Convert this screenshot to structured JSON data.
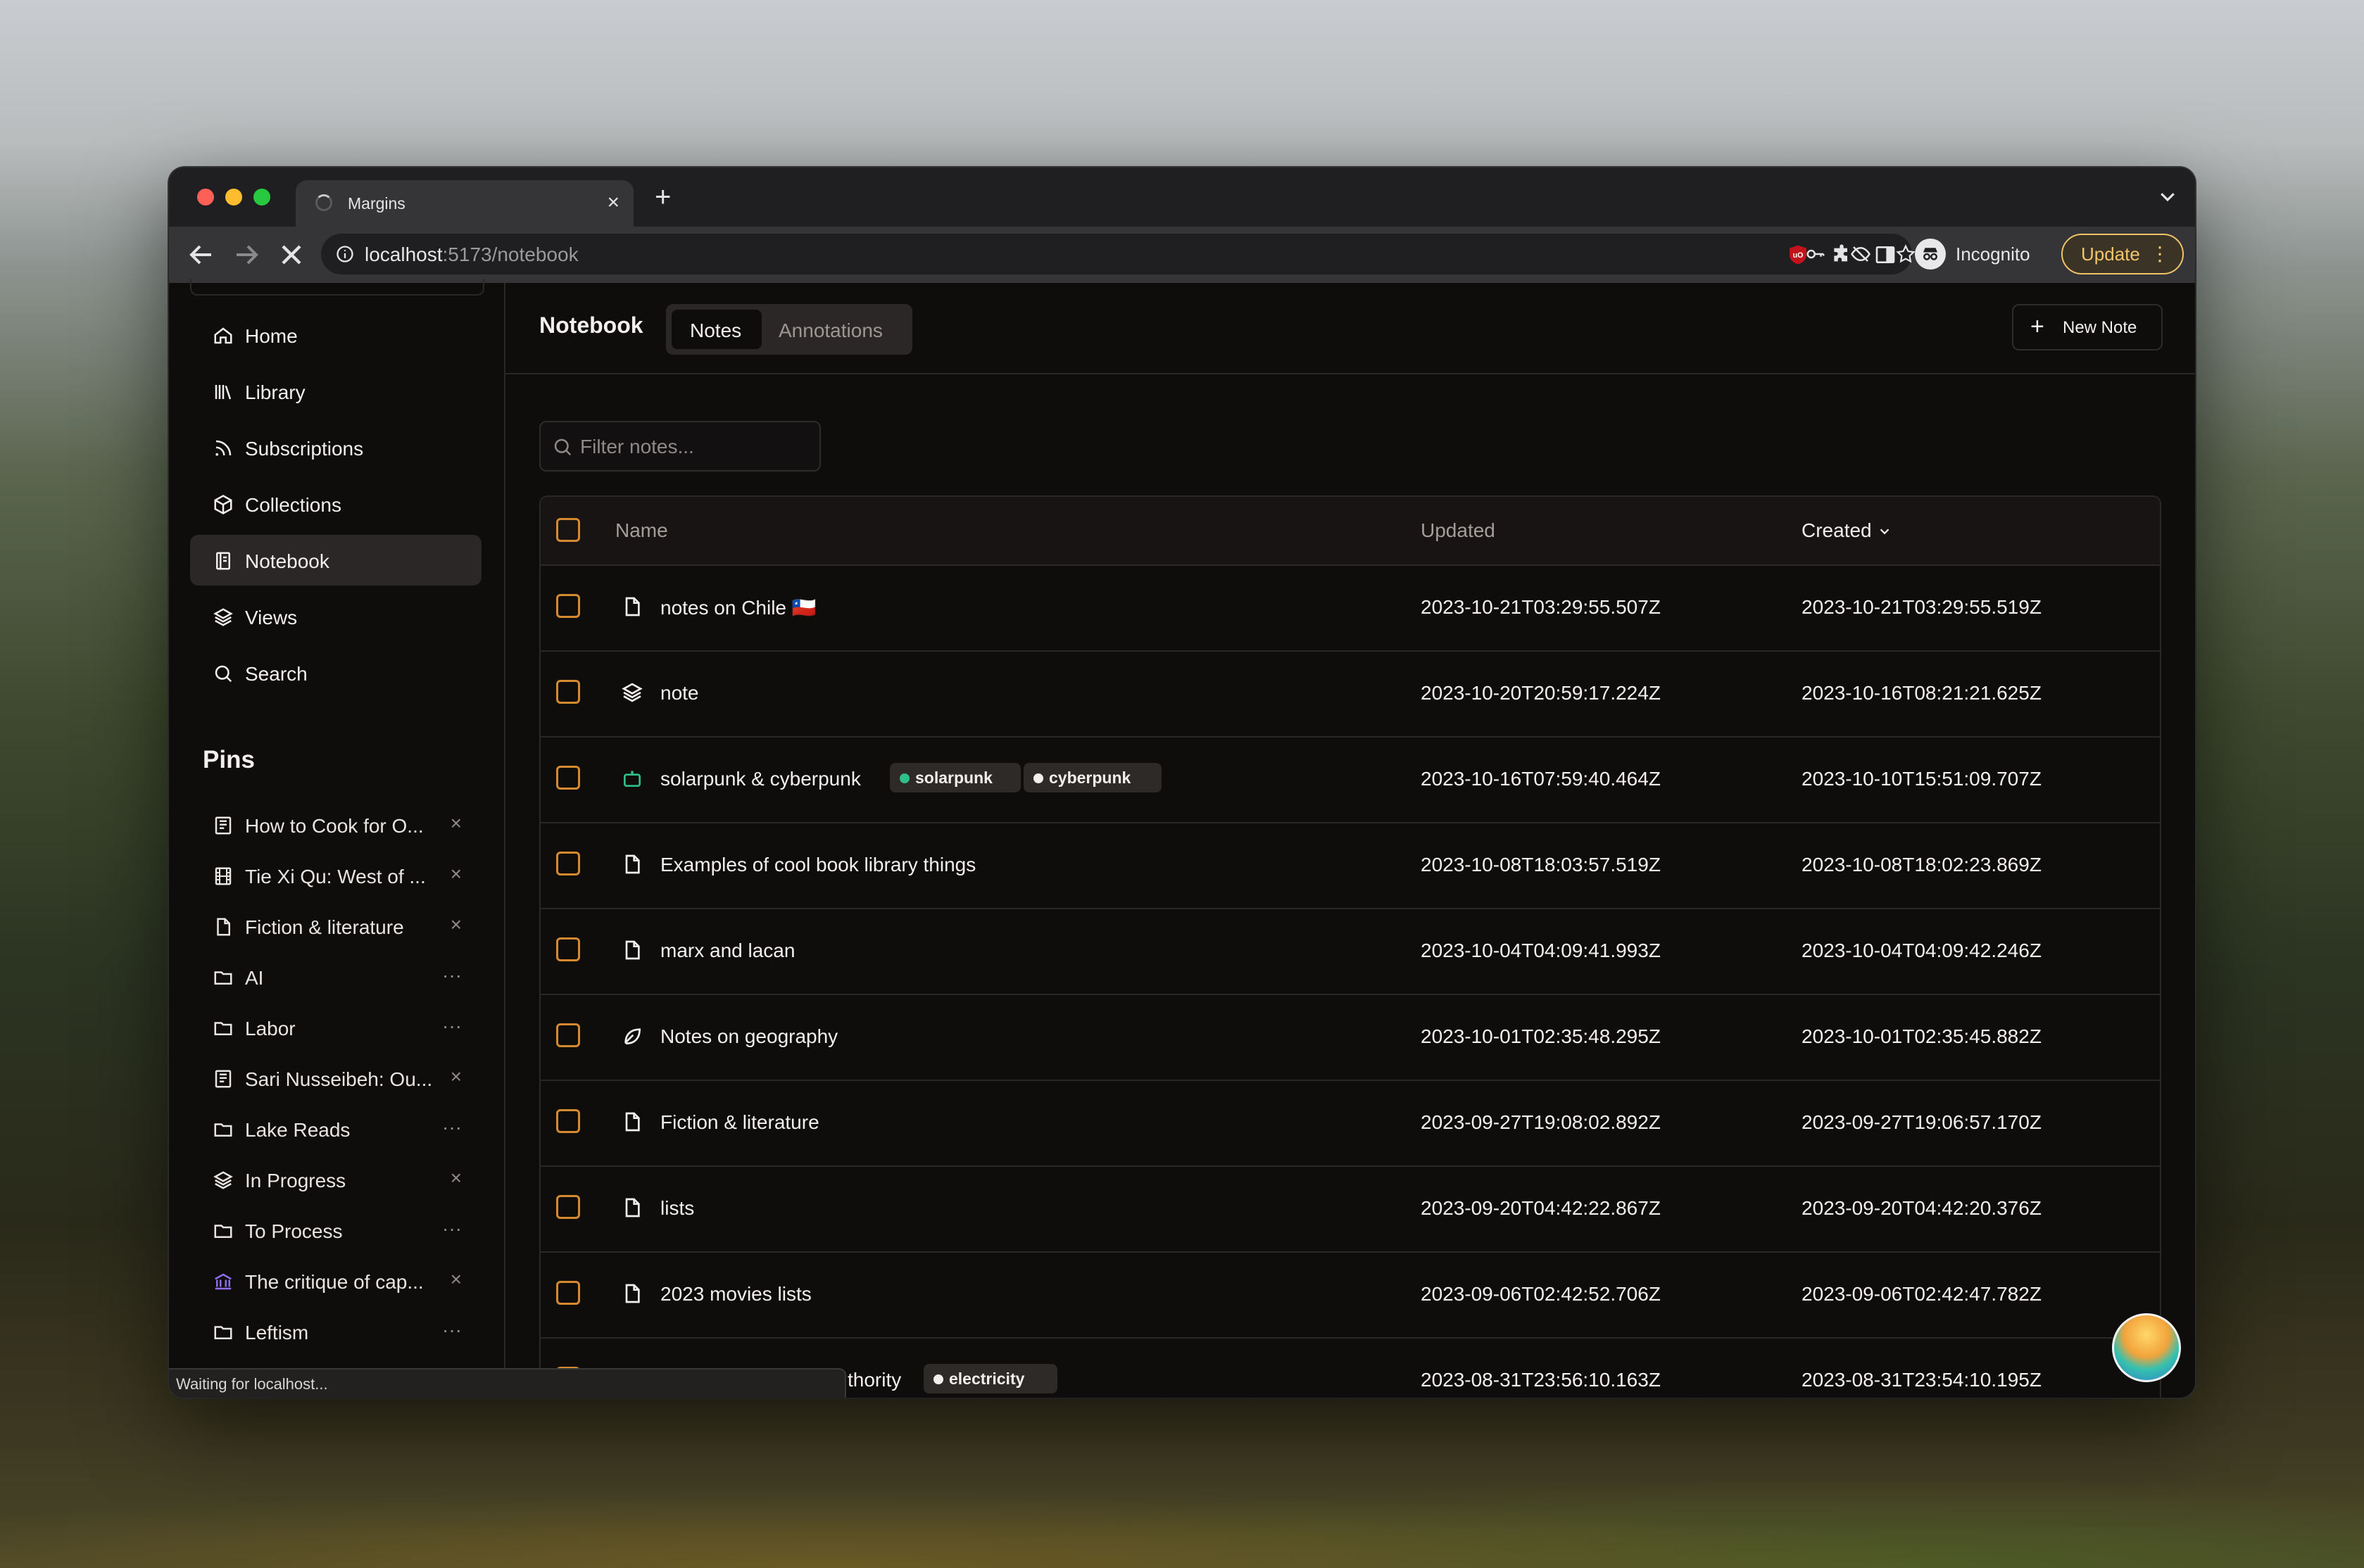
{
  "browser": {
    "tab_title": "Margins",
    "url_host": "localhost",
    "url_rest": ":5173/notebook",
    "incognito_label": "Incognito",
    "update_label": "Update"
  },
  "sidebar": {
    "nav": [
      {
        "label": "Home",
        "icon": "home-icon"
      },
      {
        "label": "Library",
        "icon": "library-icon"
      },
      {
        "label": "Subscriptions",
        "icon": "rss-icon"
      },
      {
        "label": "Collections",
        "icon": "box-icon"
      },
      {
        "label": "Notebook",
        "icon": "notebook-icon",
        "active": true
      },
      {
        "label": "Views",
        "icon": "layers-icon"
      },
      {
        "label": "Search",
        "icon": "search-icon"
      }
    ],
    "pins_heading": "Pins",
    "pins": [
      {
        "label": "How to Cook for O...",
        "icon": "article-icon",
        "action": "×"
      },
      {
        "label": "Tie Xi Qu: West of ...",
        "icon": "film-icon",
        "action": "×"
      },
      {
        "label": "Fiction & literature",
        "icon": "file-icon",
        "action": "×"
      },
      {
        "label": "AI",
        "icon": "folder-icon",
        "action": "···"
      },
      {
        "label": "Labor",
        "icon": "folder-icon",
        "action": "···"
      },
      {
        "label": "Sari Nusseibeh: Ou...",
        "icon": "article-icon",
        "action": "×"
      },
      {
        "label": "Lake Reads",
        "icon": "folder-icon",
        "action": "···"
      },
      {
        "label": "In Progress",
        "icon": "layers-icon",
        "action": "×"
      },
      {
        "label": "To Process",
        "icon": "folder-icon",
        "action": "···"
      },
      {
        "label": "The critique of cap...",
        "icon": "library-building-icon",
        "action": "×"
      },
      {
        "label": "Leftism",
        "icon": "folder-icon",
        "action": "···"
      }
    ]
  },
  "main": {
    "title": "Notebook",
    "tabs": [
      "Notes",
      "Annotations"
    ],
    "new_note_label": "New Note",
    "filter_placeholder": "Filter notes...",
    "columns": {
      "name": "Name",
      "updated": "Updated",
      "created": "Created"
    },
    "rows": [
      {
        "name": "notes on Chile 🇨🇱",
        "icon": "file-icon",
        "updated": "2023-10-21T03:29:55.507Z",
        "created": "2023-10-21T03:29:55.519Z"
      },
      {
        "name": "note",
        "icon": "layers-icon",
        "updated": "2023-10-20T20:59:17.224Z",
        "created": "2023-10-16T08:21:21.625Z"
      },
      {
        "name": "solarpunk & cyberpunk",
        "icon": "robot-icon",
        "updated": "2023-10-16T07:59:40.464Z",
        "created": "2023-10-10T15:51:09.707Z",
        "tags": [
          {
            "label": "solarpunk",
            "color": "#2fbf8a"
          },
          {
            "label": "cyberpunk",
            "color": "#f2efee"
          }
        ]
      },
      {
        "name": "Examples of cool book library things",
        "icon": "file-icon",
        "updated": "2023-10-08T18:03:57.519Z",
        "created": "2023-10-08T18:02:23.869Z"
      },
      {
        "name": "marx and lacan",
        "icon": "file-icon",
        "updated": "2023-10-04T04:09:41.993Z",
        "created": "2023-10-04T04:09:42.246Z"
      },
      {
        "name": "Notes on geography",
        "icon": "leaf-icon",
        "updated": "2023-10-01T02:35:48.295Z",
        "created": "2023-10-01T02:35:45.882Z"
      },
      {
        "name": "Fiction & literature",
        "icon": "file-icon",
        "updated": "2023-09-27T19:08:02.892Z",
        "created": "2023-09-27T19:06:57.170Z"
      },
      {
        "name": "lists",
        "icon": "file-icon",
        "updated": "2023-09-20T04:42:22.867Z",
        "created": "2023-09-20T04:42:20.376Z"
      },
      {
        "name": "2023 movies lists",
        "icon": "file-icon",
        "updated": "2023-09-06T02:42:52.706Z",
        "created": "2023-09-06T02:42:47.782Z"
      },
      {
        "name": "thority",
        "icon": "file-icon",
        "updated": "2023-08-31T23:56:10.163Z",
        "created": "2023-08-31T23:54:10.195Z",
        "tags": [
          {
            "label": "electricity",
            "color": "#f2efee"
          }
        ]
      }
    ]
  },
  "status_text": "Waiting for localhost...",
  "colors": {
    "accent_checkbox": "#d58a2f",
    "update_button": "#f3c46d",
    "active_nav": "#2b2726"
  }
}
